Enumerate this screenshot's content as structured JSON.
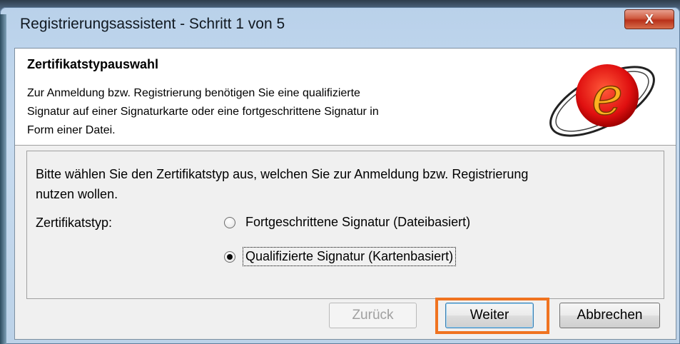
{
  "window": {
    "title": "Registrierungsassistent - Schritt 1 von 5",
    "close_label": "X"
  },
  "header": {
    "title": "Zertifikatstypauswahl",
    "description_lines": [
      "Zur Anmeldung bzw. Registrierung benötigen Sie eine qualifizierte",
      "Signatur auf einer Signaturkarte oder eine fortgeschrittene Signatur in",
      "Form einer Datei."
    ],
    "logo_letter": "e"
  },
  "form": {
    "instruction_lines": [
      "Bitte wählen Sie den Zertifikatstyp aus, welchen Sie zur Anmeldung bzw. Registrierung",
      "nutzen wollen."
    ],
    "type_label": "Zertifikatstyp:",
    "options": [
      {
        "label": "Fortgeschrittene Signatur (Dateibasiert)",
        "checked": false
      },
      {
        "label": "Qualifizierte Signatur (Kartenbasiert)",
        "checked": true
      }
    ]
  },
  "buttons": {
    "back": {
      "label": "Zurück",
      "enabled": false
    },
    "next": {
      "label": "Weiter",
      "enabled": true
    },
    "cancel": {
      "label": "Abbrechen",
      "enabled": true
    }
  },
  "colors": {
    "highlight": "#f07320",
    "logo_red": "#e01010",
    "logo_orange": "#ffb020"
  }
}
